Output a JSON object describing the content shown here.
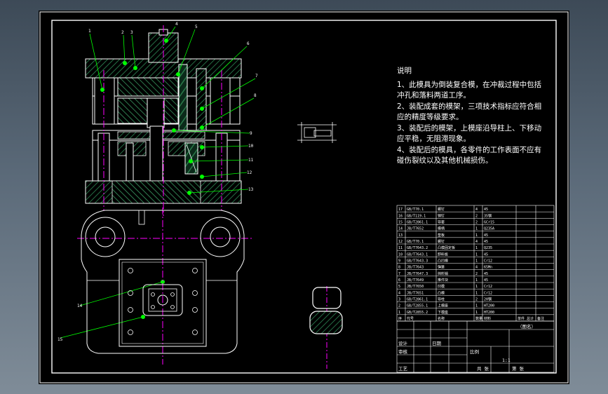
{
  "notes": {
    "title": "说明",
    "lines": [
      "1、此模具为倒装复合模，在冲裁过程中包括",
      "冲孔和落料两道工序。",
      "2、装配成套的模架，三项技术指标应符合相",
      "应的精度等级要求。",
      "3、装配后的模架，上模座沿导柱上、下移动",
      "应平稳，无阻滞现象。",
      "4、装配后的模具，各零件的工作表面不应有",
      "碰伤裂纹以及其他机械损伤。"
    ]
  },
  "part_numbers": [
    "1",
    "2",
    "3",
    "4",
    "5",
    "6",
    "7",
    "8",
    "9",
    "10",
    "11",
    "12",
    "13",
    "14",
    "15",
    "16",
    "17"
  ],
  "bom_rows": [
    {
      "no": "17",
      "std": "GB/T70.1",
      "name": "螺钉",
      "qty": "4",
      "mat": "45"
    },
    {
      "no": "16",
      "std": "GB/T119.1",
      "name": "销钉",
      "qty": "2",
      "mat": "35钢"
    },
    {
      "no": "15",
      "std": "GB/T2861.1",
      "name": "导套",
      "qty": "2",
      "mat": "GCr15"
    },
    {
      "no": "14",
      "std": "JB/T7652",
      "name": "模柄",
      "qty": "1",
      "mat": "Q235A"
    },
    {
      "no": "13",
      "std": "",
      "name": "垫板",
      "qty": "1",
      "mat": "45"
    },
    {
      "no": "12",
      "std": "GB/T70.1",
      "name": "螺钉",
      "qty": "4",
      "mat": "45"
    },
    {
      "no": "11",
      "std": "GB/T7643.2",
      "name": "凸模固定板",
      "qty": "1",
      "mat": "Q235"
    },
    {
      "no": "10",
      "std": "GB/T7643.1",
      "name": "卸料板",
      "qty": "1",
      "mat": "45"
    },
    {
      "no": "9",
      "std": "GB/T7643.3",
      "name": "凸凹模",
      "qty": "1",
      "mat": "Cr12"
    },
    {
      "no": "8",
      "std": "JB/T7643",
      "name": "弹簧",
      "qty": "4",
      "mat": "65Mn"
    },
    {
      "no": "7",
      "std": "JB/T7647.3",
      "name": "挡料销",
      "qty": "2",
      "mat": "45"
    },
    {
      "no": "6",
      "std": "JB/T7649",
      "name": "推件块",
      "qty": "1",
      "mat": "45"
    },
    {
      "no": "5",
      "std": "JB/T7650",
      "name": "凹模",
      "qty": "1",
      "mat": "Cr12"
    },
    {
      "no": "4",
      "std": "JB/T7651",
      "name": "凸模",
      "qty": "1",
      "mat": "Cr12"
    },
    {
      "no": "3",
      "std": "GB/T2861.1",
      "name": "导柱",
      "qty": "2",
      "mat": "20钢"
    },
    {
      "no": "2",
      "std": "GB/T2855.1",
      "name": "上模座",
      "qty": "1",
      "mat": "HT200"
    },
    {
      "no": "1",
      "std": "GB/T2855.2",
      "name": "下模座",
      "qty": "1",
      "mat": "HT200"
    }
  ],
  "bom_header": {
    "no": "序",
    "std": "代号",
    "name": "名称",
    "qty": "数量",
    "mat": "材料",
    "weight": "单件 总计",
    "remark": "备注"
  },
  "title_block": {
    "drawing_title": "（图名）",
    "designer_label": "设计",
    "checker_label": "审核",
    "process_label": "工艺",
    "date_label": "日期",
    "scale_label": "比例",
    "sheet_label": "第 张",
    "total_label": "共 张",
    "ratio": "1:1"
  },
  "colors": {
    "frame": "#ffffff",
    "background": "#000000",
    "part_line": "#ffffff",
    "hatch": "#2e8b57",
    "center_line": "#ff00ff",
    "leader": "#00ff00"
  }
}
